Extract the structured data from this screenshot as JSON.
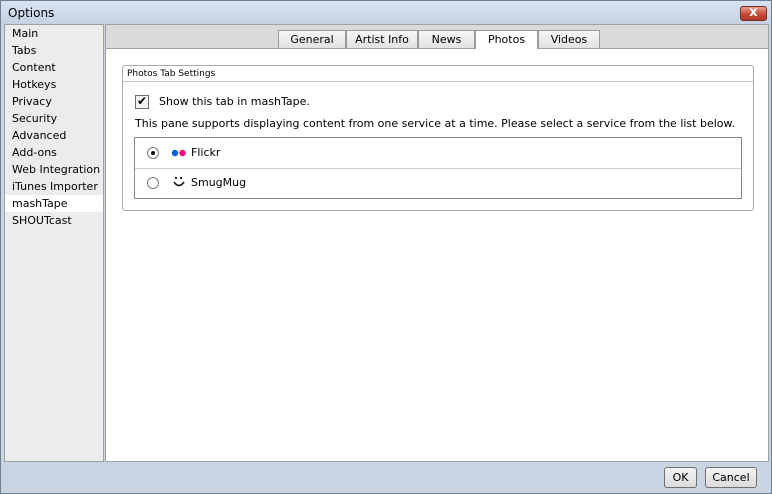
{
  "window": {
    "title": "Options",
    "close_glyph": "x"
  },
  "sidebar": {
    "items": [
      {
        "label": "Main"
      },
      {
        "label": "Tabs"
      },
      {
        "label": "Content"
      },
      {
        "label": "Hotkeys"
      },
      {
        "label": "Privacy"
      },
      {
        "label": "Security"
      },
      {
        "label": "Advanced"
      },
      {
        "label": "Add-ons"
      },
      {
        "label": "Web Integration"
      },
      {
        "label": "iTunes Importer"
      },
      {
        "label": "mashTape"
      },
      {
        "label": "SHOUTcast"
      }
    ],
    "selected": "mashTape"
  },
  "tabs": [
    {
      "label": "General"
    },
    {
      "label": "Artist Info"
    },
    {
      "label": "News"
    },
    {
      "label": "Photos"
    },
    {
      "label": "Videos"
    }
  ],
  "active_tab": "Photos",
  "group": {
    "title": "Photos Tab Settings",
    "show_tab_label": "Show this tab in mashTape.",
    "show_tab_checked": true,
    "description": "This pane supports displaying content from one service at a time. Please select a service from the list below.",
    "services": [
      {
        "name": "Flickr",
        "icon": "flickr-icon",
        "selected": true
      },
      {
        "name": "SmugMug",
        "icon": "smugmug-icon",
        "selected": false
      }
    ]
  },
  "buttons": {
    "ok": "OK",
    "cancel": "Cancel"
  },
  "colors": {
    "flickr_blue": "#0063dc",
    "flickr_pink": "#ff0084",
    "close_red": "#c44a36"
  }
}
